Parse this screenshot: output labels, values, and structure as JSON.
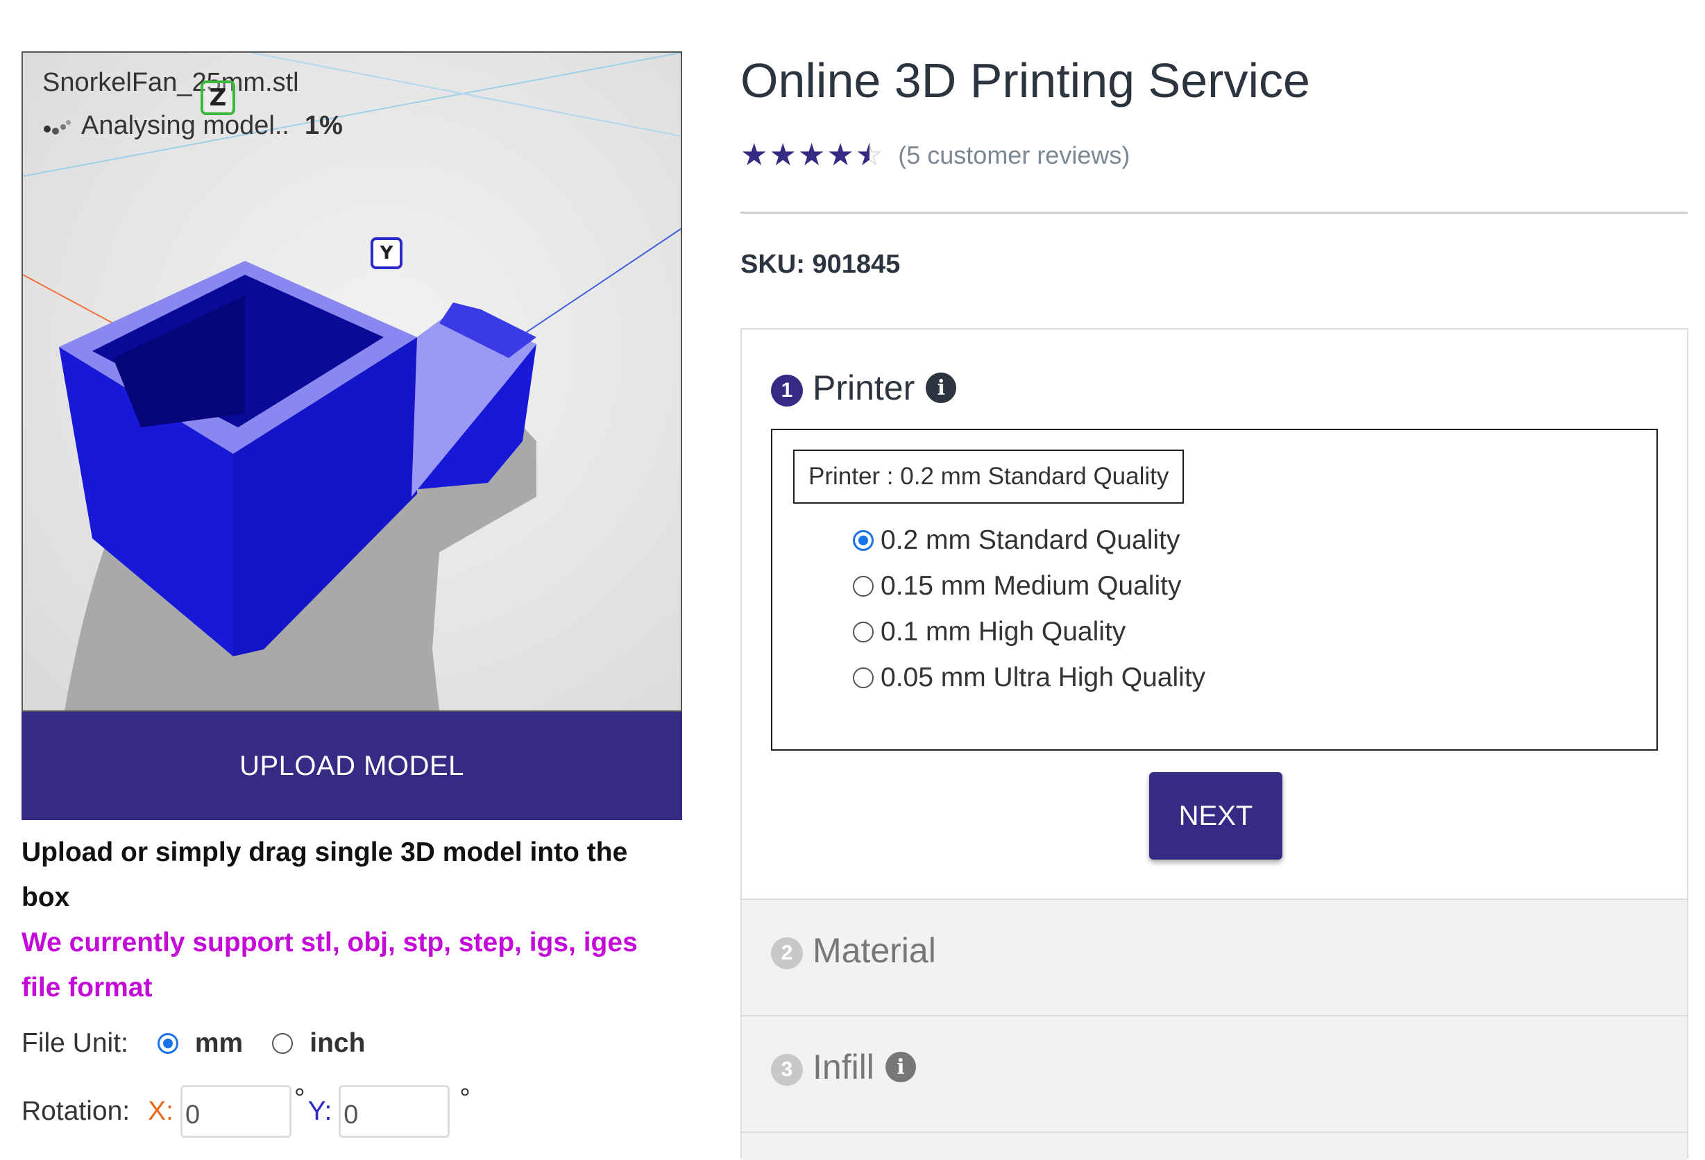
{
  "viewer": {
    "file_name": "SnorkelFan_25mm.stl",
    "status_label": "Analysing model..",
    "status_percent": "1%",
    "axis_z": "Z",
    "axis_y": "Y",
    "model_color": "#1a1ae0"
  },
  "upload": {
    "button_label": "UPLOAD MODEL",
    "instruction": "Upload or simply drag single 3D model into the box",
    "formats_note": "We currently support stl, obj, stp, step, igs, iges file format"
  },
  "file_unit": {
    "label": "File Unit:",
    "options": [
      "mm",
      "inch"
    ],
    "selected": "mm"
  },
  "rotation": {
    "label": "Rotation:",
    "x_label": "X:",
    "y_label": "Y:",
    "x_value": "0",
    "y_value": "0",
    "degree_symbol": "°",
    "degree_y_label": "°Y:"
  },
  "product": {
    "title": "Online 3D Printing Service",
    "rating": 4.5,
    "rating_max": 5,
    "reviews_text": "(5 customer reviews)",
    "sku_label": "SKU:",
    "sku_value": "901845"
  },
  "steps": [
    {
      "number": "1",
      "label": "Printer",
      "has_info": true,
      "active": true
    },
    {
      "number": "2",
      "label": "Material",
      "has_info": false,
      "active": false
    },
    {
      "number": "3",
      "label": "Infill",
      "has_info": true,
      "active": false
    }
  ],
  "printer": {
    "select_value": "Printer : 0.2 mm Standard Quality",
    "options": [
      "0.2 mm Standard Quality",
      "0.15 mm Medium Quality",
      "0.1 mm High Quality",
      "0.05 mm Ultra High Quality"
    ],
    "selected_index": 0,
    "next_label": "NEXT"
  },
  "colors": {
    "brand": "#362b84",
    "support_note": "#c40ad8",
    "radio_selected": "#1a73e8"
  }
}
